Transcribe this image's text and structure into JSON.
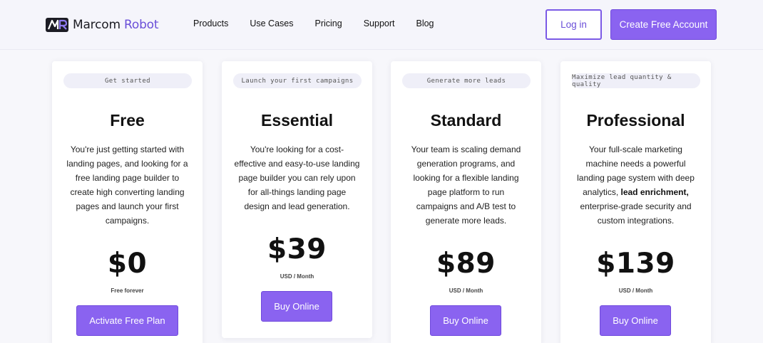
{
  "header": {
    "logo": {
      "text_main": "Marcom",
      "text_accent": "Robot",
      "icon": "marcom-robot-logo-icon"
    },
    "nav": [
      "Products",
      "Use Cases",
      "Pricing",
      "Support",
      "Blog"
    ],
    "login_label": "Log in",
    "create_label": "Create Free Account"
  },
  "colors": {
    "accent": "#8a63f0",
    "accent_text": "#6a4fd8",
    "pill_bg": "#efeff8"
  },
  "plans": [
    {
      "tag": "Get started",
      "name": "Free",
      "desc_lines": [
        "You're just getting started with",
        "landing pages, and looking for a",
        "free landing page builder to",
        "create high converting landing",
        "pages and launch your first",
        "campaigns."
      ],
      "price": "$0",
      "note": "Free forever",
      "button": "Activate Free Plan"
    },
    {
      "tag": "Launch your first campaigns",
      "name": "Essential",
      "desc_lines": [
        "You're looking for a cost-",
        "effective and easy-to-use landing",
        "page builder you can rely upon",
        "for all-things landing page",
        "design and lead generation."
      ],
      "price": "$39",
      "note": "USD / Month",
      "button": "Buy Online"
    },
    {
      "tag": "Generate more leads",
      "name": "Standard",
      "desc_lines": [
        "Your team is scaling demand",
        "generation programs, and",
        "looking for a flexible landing",
        "page platform to run",
        "campaigns and A/B test to",
        "generate more leads."
      ],
      "price": "$89",
      "note": "USD / Month",
      "button": "Buy Online"
    },
    {
      "tag": "Maximize lead quantity & quality",
      "name": "Professional",
      "desc_lines": [
        "Your full-scale marketing",
        "machine needs a powerful",
        "landing page system with deep",
        "analytics, ",
        "enterprise-grade security and",
        "custom integrations."
      ],
      "desc_bold": "lead enrichment,",
      "price": "$139",
      "note": "USD / Month",
      "button": "Buy Online"
    }
  ]
}
